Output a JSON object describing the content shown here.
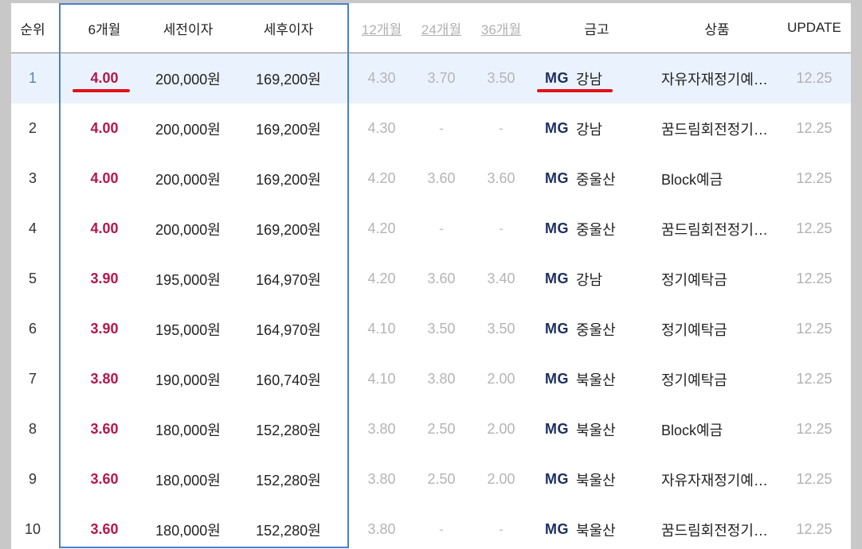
{
  "headers": {
    "rank": "순위",
    "m6": "6개월",
    "pretax": "세전이자",
    "posttax": "세후이자",
    "m12": "12개월",
    "m24": "24개월",
    "m36": "36개월",
    "bank": "금고",
    "product": "상품",
    "update": "UPDATE"
  },
  "rows": [
    {
      "rank": "1",
      "m6": "4.00",
      "pretax": "200,000원",
      "posttax": "169,200원",
      "m12": "4.30",
      "m24": "3.70",
      "m36": "3.50",
      "bank_logo": "MG",
      "bank": "강남",
      "product": "자유자재정기예…",
      "update": "12.25"
    },
    {
      "rank": "2",
      "m6": "4.00",
      "pretax": "200,000원",
      "posttax": "169,200원",
      "m12": "4.30",
      "m24": "-",
      "m36": "-",
      "bank_logo": "MG",
      "bank": "강남",
      "product": "꿈드림회전정기…",
      "update": "12.25"
    },
    {
      "rank": "3",
      "m6": "4.00",
      "pretax": "200,000원",
      "posttax": "169,200원",
      "m12": "4.20",
      "m24": "3.60",
      "m36": "3.60",
      "bank_logo": "MG",
      "bank": "중울산",
      "product": "Block예금",
      "update": "12.25"
    },
    {
      "rank": "4",
      "m6": "4.00",
      "pretax": "200,000원",
      "posttax": "169,200원",
      "m12": "4.20",
      "m24": "-",
      "m36": "-",
      "bank_logo": "MG",
      "bank": "중울산",
      "product": "꿈드림회전정기…",
      "update": "12.25"
    },
    {
      "rank": "5",
      "m6": "3.90",
      "pretax": "195,000원",
      "posttax": "164,970원",
      "m12": "4.20",
      "m24": "3.60",
      "m36": "3.40",
      "bank_logo": "MG",
      "bank": "강남",
      "product": "정기예탁금",
      "update": "12.25"
    },
    {
      "rank": "6",
      "m6": "3.90",
      "pretax": "195,000원",
      "posttax": "164,970원",
      "m12": "4.10",
      "m24": "3.50",
      "m36": "3.50",
      "bank_logo": "MG",
      "bank": "중울산",
      "product": "정기예탁금",
      "update": "12.25"
    },
    {
      "rank": "7",
      "m6": "3.80",
      "pretax": "190,000원",
      "posttax": "160,740원",
      "m12": "4.10",
      "m24": "3.80",
      "m36": "2.00",
      "bank_logo": "MG",
      "bank": "북울산",
      "product": "정기예탁금",
      "update": "12.25"
    },
    {
      "rank": "8",
      "m6": "3.60",
      "pretax": "180,000원",
      "posttax": "152,280원",
      "m12": "3.80",
      "m24": "2.50",
      "m36": "2.00",
      "bank_logo": "MG",
      "bank": "북울산",
      "product": "Block예금",
      "update": "12.25"
    },
    {
      "rank": "9",
      "m6": "3.60",
      "pretax": "180,000원",
      "posttax": "152,280원",
      "m12": "3.80",
      "m24": "2.50",
      "m36": "2.00",
      "bank_logo": "MG",
      "bank": "북울산",
      "product": "자유자재정기예…",
      "update": "12.25"
    },
    {
      "rank": "10",
      "m6": "3.60",
      "pretax": "180,000원",
      "posttax": "152,280원",
      "m12": "3.80",
      "m24": "-",
      "m36": "-",
      "bank_logo": "MG",
      "bank": "북울산",
      "product": "꿈드림회전정기…",
      "update": "12.25"
    }
  ],
  "colors": {
    "rate_accent": "#b3184a",
    "highlight_row": "#eaf3fd",
    "annotation_box": "#4a7fd0",
    "annotation_underline": "#e2101a",
    "bank_logo": "#1d2f5e"
  }
}
